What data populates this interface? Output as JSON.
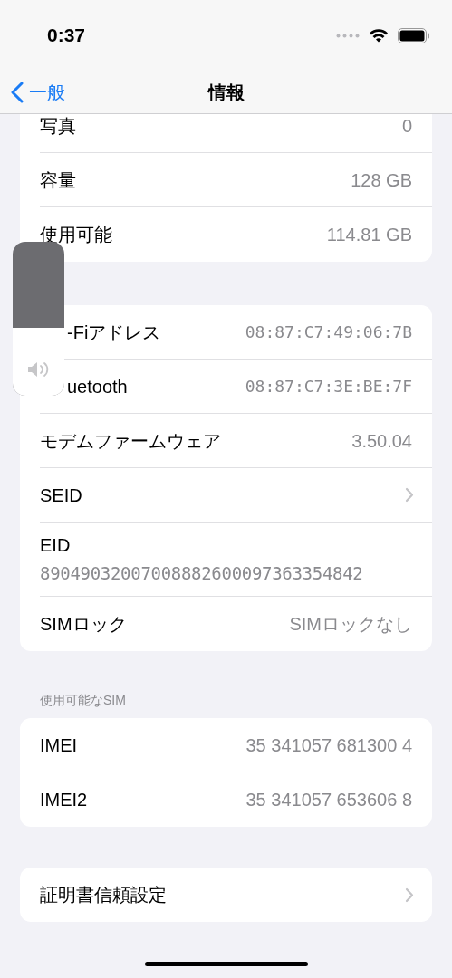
{
  "status_bar": {
    "time": "0:37"
  },
  "nav": {
    "back": "一般",
    "title": "情報"
  },
  "sections": [
    {
      "rows": [
        {
          "kind": "value",
          "label": "写真",
          "value": "0"
        },
        {
          "kind": "value",
          "label": "容量",
          "value": "128 GB"
        },
        {
          "kind": "value",
          "label": "使用可能",
          "value": "114.81 GB"
        }
      ]
    },
    {
      "rows": [
        {
          "kind": "address",
          "label": "-Fiアドレス",
          "value": "08:87:C7:49:06:7B"
        },
        {
          "kind": "address",
          "label": "uetooth",
          "value": "08:87:C7:3E:BE:7F"
        },
        {
          "kind": "value",
          "label": "モデムファームウェア",
          "value": "3.50.04"
        },
        {
          "kind": "disclosure",
          "label": "SEID"
        },
        {
          "kind": "stacked",
          "label": "EID",
          "value": "89049032007008882600097363354842"
        },
        {
          "kind": "value",
          "label": "SIMロック",
          "value": "SIMロックなし"
        }
      ]
    },
    {
      "header": "使用可能なSIM",
      "rows": [
        {
          "kind": "value",
          "label": "IMEI",
          "value": "35 341057 681300 4"
        },
        {
          "kind": "value",
          "label": "IMEI2",
          "value": "35 341057 653606 8"
        }
      ]
    },
    {
      "rows": [
        {
          "kind": "disclosure",
          "label": "証明書信頼設定"
        }
      ]
    }
  ],
  "volume_hud": {
    "level": 0.44
  }
}
